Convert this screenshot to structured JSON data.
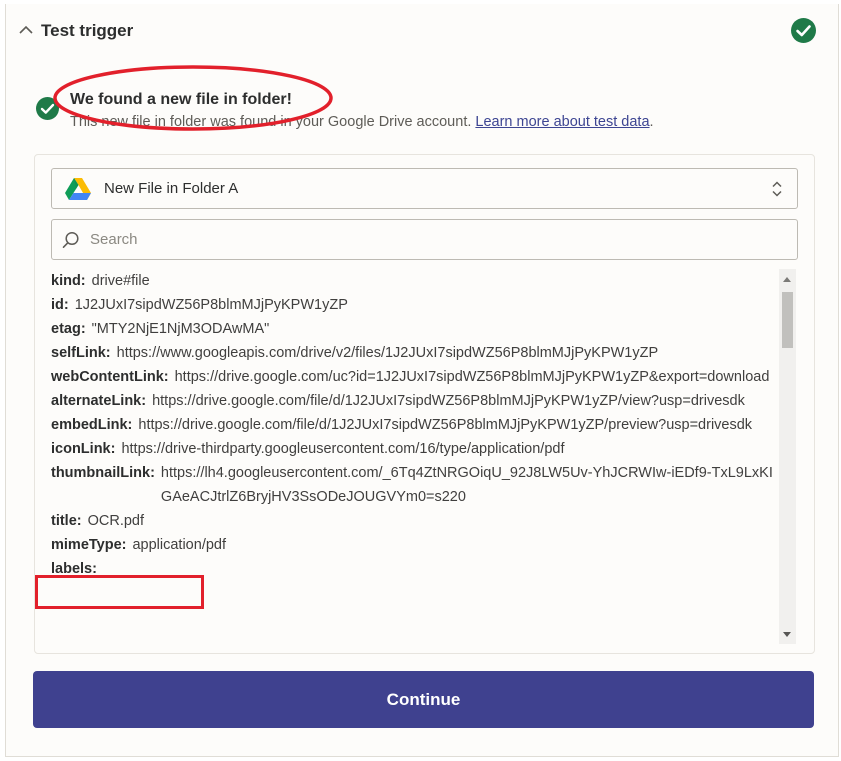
{
  "header": {
    "title": "Test trigger"
  },
  "result": {
    "title": "We found a new file in folder!",
    "description": "This new file in folder was found in your Google Drive account.",
    "link_text": "Learn more about test data",
    "link_suffix": "."
  },
  "selector": {
    "selected": "New File in Folder A"
  },
  "search": {
    "placeholder": "Search",
    "value": ""
  },
  "records": [
    {
      "key": "kind:",
      "value": "drive#file"
    },
    {
      "key": "id:",
      "value": "1J2JUxI7sipdWZ56P8blmMJjPyKPW1yZP"
    },
    {
      "key": "etag:",
      "value": "\"MTY2NjE1NjM3ODAwMA\""
    },
    {
      "key": "selfLink:",
      "value": "https://www.googleapis.com/drive/v2/files/1J2JUxI7sipdWZ56P8blmMJjPyKPW1yZP"
    },
    {
      "key": "webContentLink:",
      "value": "https://drive.google.com/uc?id=1J2JUxI7sipdWZ56P8blmMJjPyKPW1yZP&export=download"
    },
    {
      "key": "alternateLink:",
      "value": "https://drive.google.com/file/d/1J2JUxI7sipdWZ56P8blmMJjPyKPW1yZP/view?usp=drivesdk"
    },
    {
      "key": "embedLink:",
      "value": "https://drive.google.com/file/d/1J2JUxI7sipdWZ56P8blmMJjPyKPW1yZP/preview?usp=drivesdk"
    },
    {
      "key": "iconLink:",
      "value": "https://drive-thirdparty.googleusercontent.com/16/type/application/pdf"
    },
    {
      "key": "thumbnailLink:",
      "value": "https://lh4.googleusercontent.com/_6Tq4ZtNRGOiqU_92J8LW5Uv-YhJCRWIw-iEDf9-TxL9LxKIGAeACJtrlZ6BryjHV3SsODeJOUGVYm0=s220"
    },
    {
      "key": "title:",
      "value": "OCR.pdf"
    },
    {
      "key": "mimeType:",
      "value": "application/pdf"
    },
    {
      "key": "labels:",
      "value": ""
    }
  ],
  "actions": {
    "continue_label": "Continue"
  },
  "colors": {
    "success": "#1f7a48",
    "primary": "#3f418f",
    "annotation": "#e2202b",
    "link": "#3d4592"
  },
  "icons": {
    "header_status": "check-circle-icon",
    "collapse": "chevron-up-icon",
    "app": "google-drive-icon",
    "selector": "sort-arrows-icon",
    "search": "search-icon"
  }
}
